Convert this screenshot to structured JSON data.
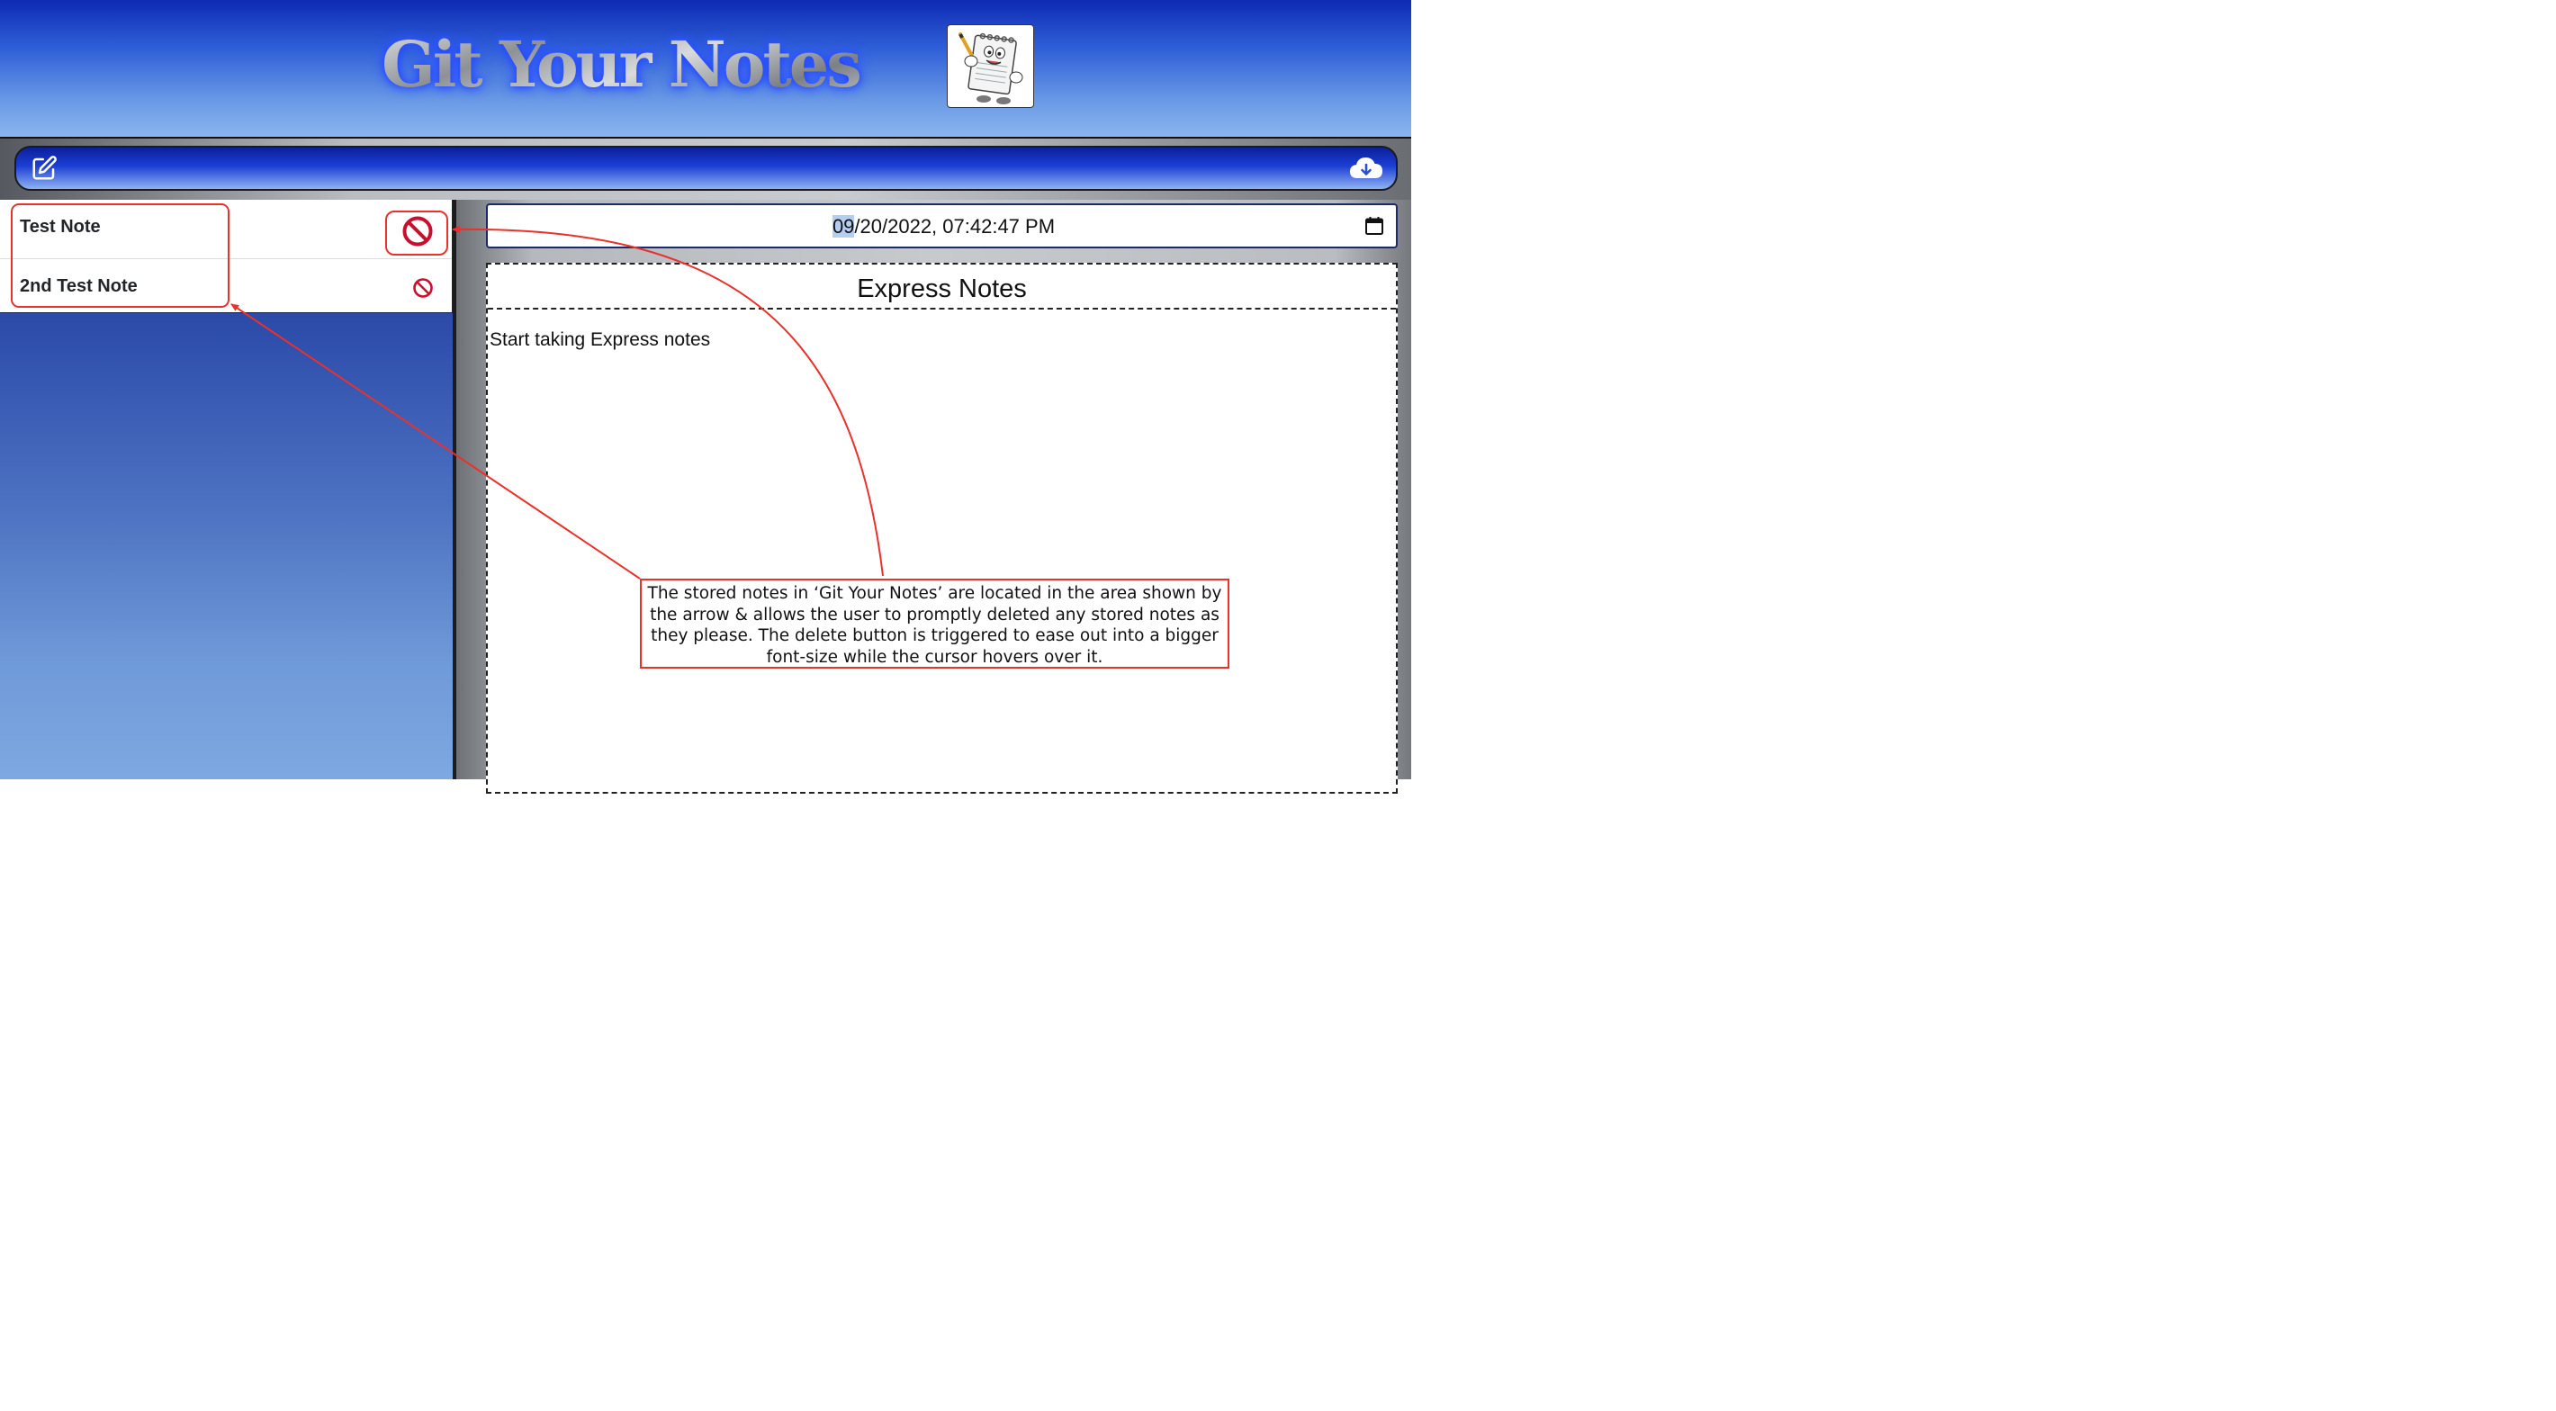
{
  "header": {
    "brand_title": "Git Your Notes",
    "logo_icon": "notepad-mascot-icon"
  },
  "toolbar": {
    "new_note_icon": "pencil-square-icon",
    "save_icon": "cloud-download-icon"
  },
  "notes": [
    {
      "title": "Test Note",
      "delete_icon": "prohibited-icon"
    },
    {
      "title": "2nd Test Note",
      "delete_icon": "prohibited-icon"
    }
  ],
  "editor": {
    "date_highlight": "09",
    "date_rest": "/20/2022, 07:42:47 PM",
    "calendar_icon": "calendar-icon",
    "panel_title": "Express Notes",
    "body_text": "Start taking Express notes"
  },
  "annotation": {
    "text": "The stored notes in ‘Git Your Notes’ are located in the area shown by the arrow & allows the user to promptly deleted any stored notes as they please. The delete button is triggered to ease out into a bigger font-size while the cursor hovers over it."
  },
  "colors": {
    "annotation_red": "#e8322b",
    "delete_red": "#c8102e",
    "header_blue": "#0d2bb3"
  }
}
